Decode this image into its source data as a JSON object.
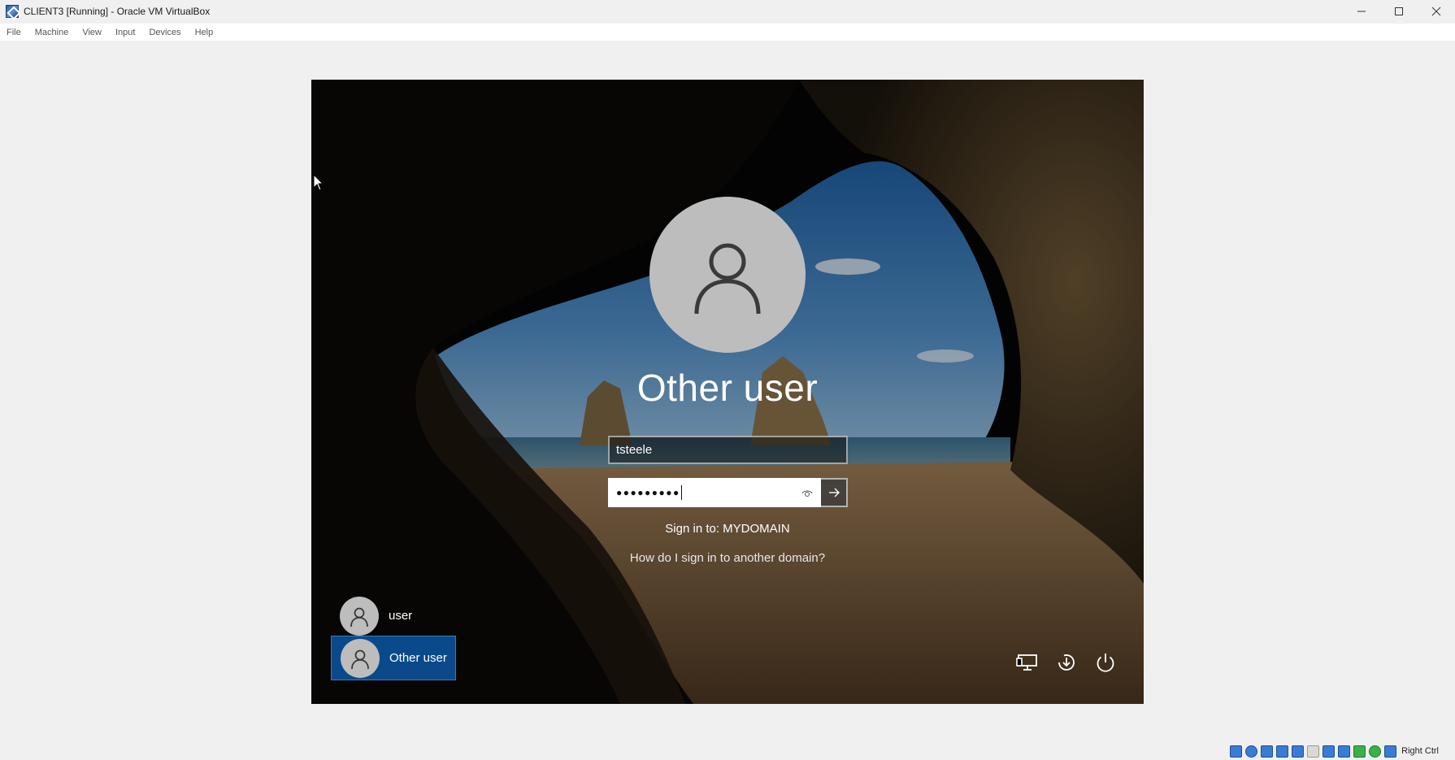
{
  "window": {
    "title": "CLIENT3 [Running] - Oracle VM VirtualBox",
    "controls": [
      "minimize-icon",
      "maximize-icon",
      "close-icon"
    ]
  },
  "menu": {
    "items": [
      "File",
      "Machine",
      "View",
      "Input",
      "Devices",
      "Help"
    ]
  },
  "login": {
    "user_name": "Other user",
    "username_value": "tsteele",
    "password_masked": "●●●●●●●●●",
    "sign_in_to": "Sign in to: MYDOMAIN",
    "other_domain_link": "How do I sign in to another domain?"
  },
  "user_tiles": [
    {
      "label": "user",
      "selected": false
    },
    {
      "label": "Other user",
      "selected": true
    }
  ],
  "corner_icons": [
    "network-icon",
    "accessibility-icon",
    "power-icon"
  ],
  "statusbar": {
    "host_key": "Right Ctrl",
    "icons": [
      "hard-disk-icon",
      "optical-drive-icon",
      "audio-icon",
      "network-adapter-icon",
      "usb-icon",
      "shared-folder-icon",
      "display-icon",
      "recording-icon",
      "cpu-icon",
      "mouse-integration-icon",
      "keyboard-icon"
    ]
  },
  "colors": {
    "selected_tile": "#0a4a8a",
    "avatar_gray": "#bdbdbd"
  }
}
